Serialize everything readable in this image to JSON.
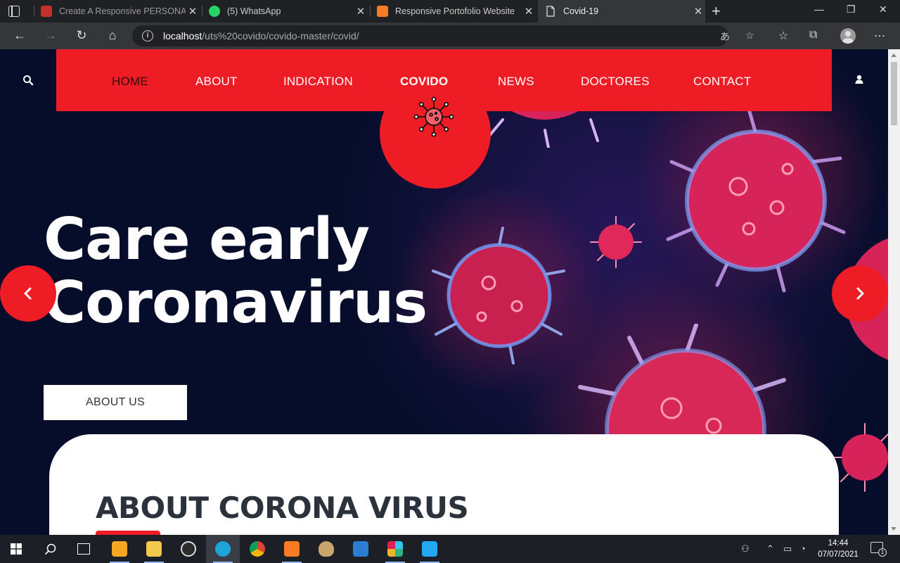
{
  "browser": {
    "tabs": [
      {
        "title": "Create A Responsive PERSONAL",
        "favicon": "youtube-icon",
        "color": "#e62117"
      },
      {
        "title": "(5) WhatsApp",
        "favicon": "whatsapp-icon",
        "color": "#25d366"
      },
      {
        "title": "Responsive Portofolio Website",
        "favicon": "xampp-icon",
        "color": "#fb7a24"
      },
      {
        "title": "Covid-19",
        "favicon": "page-icon",
        "color": "#dddddd"
      }
    ],
    "active_tab": 3,
    "url_host": "localhost",
    "url_path": "/uts%20covido/covido-master/covid/"
  },
  "header": {
    "nav": [
      "HOME",
      "ABOUT",
      "INDICATION",
      "COVIDO",
      "NEWS",
      "DOCTORES",
      "CONTACT"
    ],
    "accent": "#ee1c25"
  },
  "hero": {
    "line1": "Care early",
    "line2": "Coronavirus",
    "button_label": "ABOUT US"
  },
  "about": {
    "title": "ABOUT CORONA VIRUS"
  },
  "taskbar": {
    "time": "14:44",
    "date": "07/07/2021",
    "notification_count": "1"
  }
}
